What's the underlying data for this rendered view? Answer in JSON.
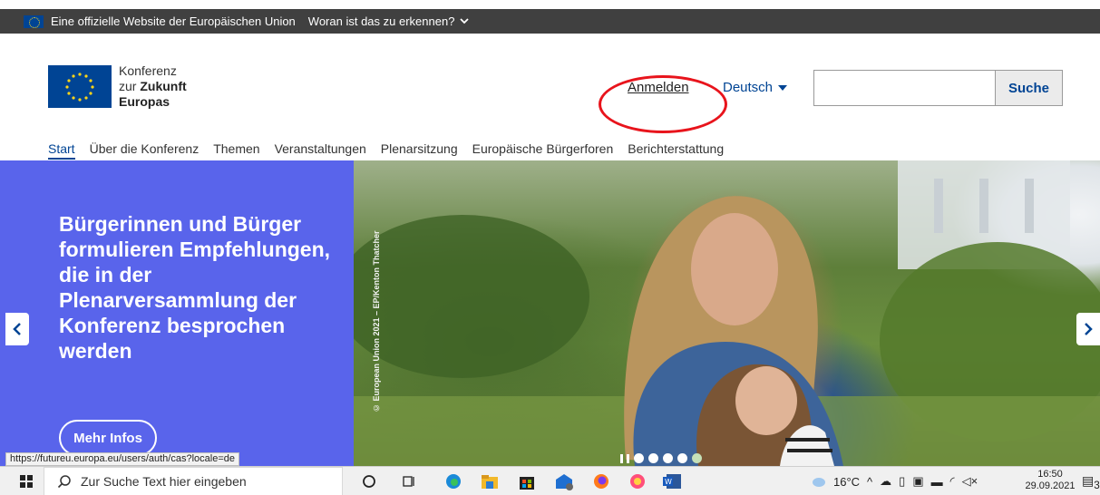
{
  "eu_bar": {
    "text": "Eine offizielle Website der Europäischen Union",
    "how_label": "Woran ist das zu erkennen?"
  },
  "header": {
    "logo_line1": "Konferenz",
    "logo_line2_prefix": "zur ",
    "logo_line2_bold": "Zukunft",
    "logo_line3": "Europas",
    "login_label": "Anmelden",
    "language_label": "Deutsch",
    "search_button": "Suche",
    "search_value": ""
  },
  "nav": {
    "items": [
      {
        "label": "Start"
      },
      {
        "label": "Über die Konferenz"
      },
      {
        "label": "Themen"
      },
      {
        "label": "Veranstaltungen"
      },
      {
        "label": "Plenarsitzung"
      },
      {
        "label": "Europäische Bürgerforen"
      },
      {
        "label": "Berichterstattung"
      }
    ]
  },
  "hero": {
    "title": "Bürgerinnen und Bürger formulieren Empfehlungen, die in der Plenarversammlung der Konferenz besprochen werden",
    "more_label": "Mehr Infos",
    "credit": "© European Union 2021 – EP/Kenton Thatcher",
    "slide_count": 5,
    "active_slide": 5
  },
  "status_url": "https://futureu.europa.eu/users/auth/cas?locale=de",
  "taskbar": {
    "search_placeholder": "Zur Suche Text hier eingeben",
    "temperature": "16°C",
    "time": "16:50",
    "date": "29.09.2021",
    "notifications": "3"
  },
  "colors": {
    "hero_blue": "#5964eb",
    "eu_blue": "#004494",
    "highlight_red": "#e8141c"
  }
}
